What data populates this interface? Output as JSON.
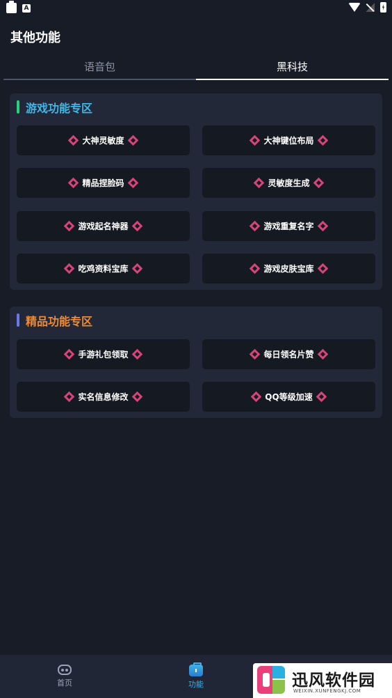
{
  "status_bar": {
    "left_icons": [
      "clipboard-icon",
      "a-notification-icon"
    ],
    "a_glyph": "A",
    "right_icons": [
      "wifi-icon",
      "signal-icon",
      "battery-charging-icon"
    ]
  },
  "header": {
    "title": "其他功能"
  },
  "tabs": [
    {
      "label": "语音包",
      "active": false
    },
    {
      "label": "黑科技",
      "active": true
    }
  ],
  "sections": [
    {
      "title": "游戏功能专区",
      "accent": "#26d07c",
      "title_color": "#3fb7e8",
      "items": [
        "大神灵敏度",
        "大神键位布局",
        "精品捏脸码",
        "灵敏度生成",
        "游戏起名神器",
        "游戏重复名字",
        "吃鸡资料宝库",
        "游戏皮肤宝库"
      ]
    },
    {
      "title": "精品功能专区",
      "accent": "#6c78e8",
      "title_color": "#f08a32",
      "items": [
        "手游礼包领取",
        "每日领名片赞",
        "实名信息修改",
        "QQ等级加速"
      ]
    }
  ],
  "bottom_nav": [
    {
      "label": "首页",
      "icon": "gamepad-icon",
      "active": false
    },
    {
      "label": "功能",
      "icon": "briefcase-icon",
      "active": true
    }
  ],
  "watermark": {
    "name": "迅风软件园",
    "url": "WEIXIN.XUNFENGKJ.COM"
  },
  "colors": {
    "background": "#181c26",
    "card": "#222837",
    "button": "#151921",
    "diamond": "#d6447a",
    "active_nav": "#3fb0e8"
  }
}
